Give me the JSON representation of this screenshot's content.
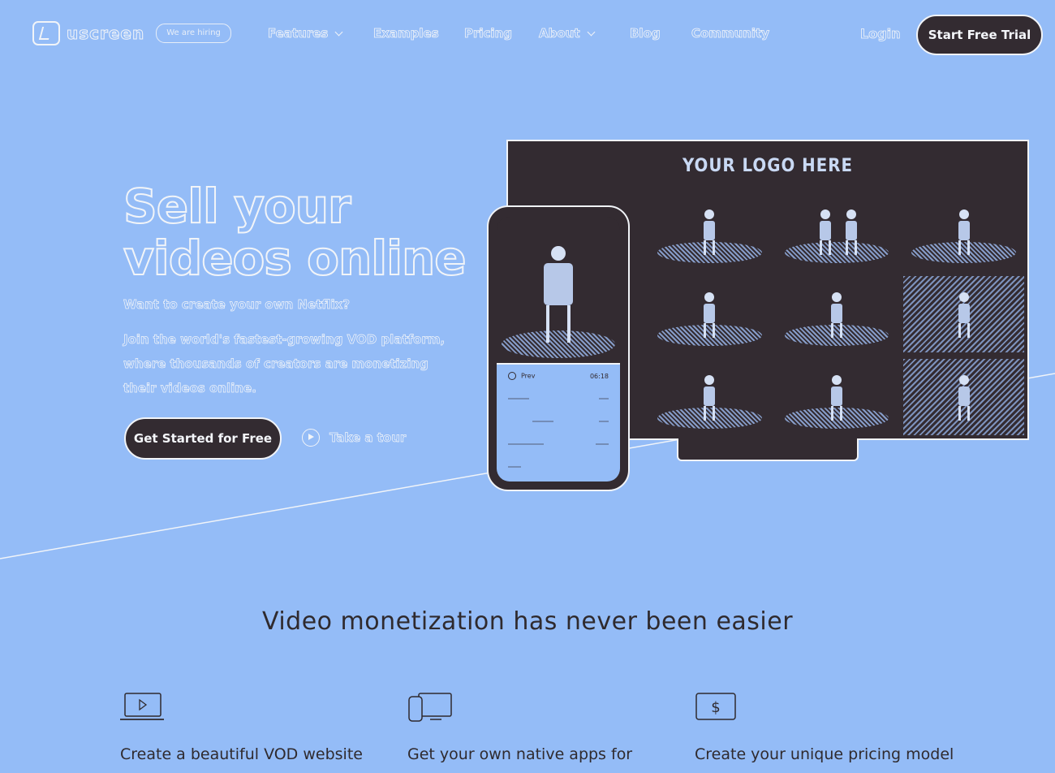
{
  "brand": {
    "name": "uscreen",
    "badge": "We are hiring"
  },
  "nav": {
    "items": [
      {
        "label": "Features",
        "has_dropdown": true
      },
      {
        "label": "Examples",
        "has_dropdown": false
      },
      {
        "label": "Pricing",
        "has_dropdown": false
      },
      {
        "label": "About",
        "has_dropdown": true
      },
      {
        "label": "Blog",
        "has_dropdown": false
      },
      {
        "label": "Community",
        "has_dropdown": false
      }
    ],
    "login_label": "Login",
    "trial_label": "Start Free Trial"
  },
  "hero": {
    "title_line1": "Sell your",
    "title_line2": "videos online",
    "subtitle": "Want to create your own Netflix?",
    "body": "Join the world's fastest-growing VOD platform, where thousands of creators are monetizing their videos online.",
    "cta_label": "Get Started for Free",
    "tour_label": "Take a tour"
  },
  "mockup": {
    "tv_logo_text": "YOUR LOGO HERE",
    "phone_time": "06:18",
    "phone_label": "Prev"
  },
  "features": {
    "section_title": "Video monetization has never been easier",
    "items": [
      {
        "icon": "laptop-play-icon",
        "title": "Create a beautiful VOD website"
      },
      {
        "icon": "devices-icon",
        "title": "Get your own native apps for"
      },
      {
        "icon": "dollar-screen-icon",
        "title": "Create your unique pricing model"
      }
    ]
  },
  "colors": {
    "background": "#94bcf7",
    "dark": "#332b31",
    "outline": "#f1f4f8"
  }
}
